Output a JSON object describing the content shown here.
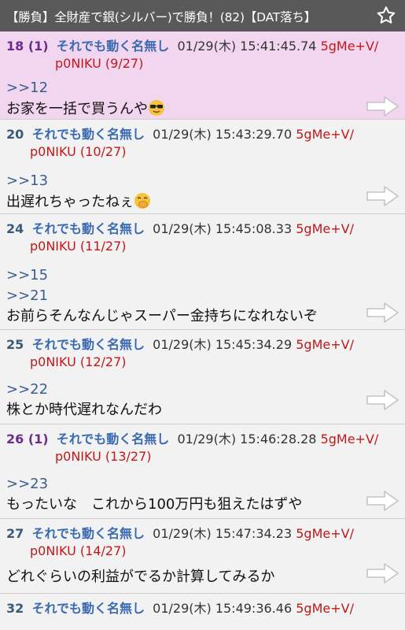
{
  "title": "【勝負】全財産で銀(シルバー)で勝負！(82)【DAT落ち】",
  "posts": [
    {
      "num": "18",
      "count": " (1)",
      "name": "それでも動く名無し",
      "date": "01/29(木) 15:41:45.74",
      "id": "5gMe+V/",
      "id2": "p0NIKU",
      "idcount": "(9/27)",
      "anchors": [
        ">>12"
      ],
      "body": "お家を一括で買うんや",
      "emoji": "sunglasses-emoji"
    },
    {
      "num": "20",
      "count": "",
      "name": "それでも動く名無し",
      "date": "01/29(木) 15:43:29.70",
      "id": "5gMe+V/",
      "id2": "p0NIKU",
      "idcount": "(10/27)",
      "anchors": [
        ">>13"
      ],
      "body": "出遅れちゃったねぇ",
      "emoji": "hand-over-mouth-emoji"
    },
    {
      "num": "24",
      "count": "",
      "name": "それでも動く名無し",
      "date": "01/29(木) 15:45:08.33",
      "id": "5gMe+V/",
      "id2": "p0NIKU",
      "idcount": "(11/27)",
      "anchors": [
        ">>15",
        ">>21"
      ],
      "body": "お前らそんなんじゃスーパー金持ちになれないぞ"
    },
    {
      "num": "25",
      "count": "",
      "name": "それでも動く名無し",
      "date": "01/29(木) 15:45:34.29",
      "id": "5gMe+V/",
      "id2": "p0NIKU",
      "idcount": "(12/27)",
      "anchors": [
        ">>22"
      ],
      "body": "株とか時代遅れなんだわ"
    },
    {
      "num": "26",
      "count": " (1)",
      "name": "それでも動く名無し",
      "date": "01/29(木) 15:46:28.28",
      "id": "5gMe+V/",
      "id2": "p0NIKU",
      "idcount": "(13/27)",
      "anchors": [
        ">>23"
      ],
      "body": "もったいな　これから100万円も狙えたはずや"
    },
    {
      "num": "27",
      "count": "",
      "name": "それでも動く名無し",
      "date": "01/29(木) 15:47:34.23",
      "id": "5gMe+V/",
      "id2": "p0NIKU",
      "idcount": "(14/27)",
      "anchors": [],
      "body": "どれぐらいの利益がでるか計算してみるか"
    },
    {
      "num": "32",
      "count": "",
      "name": "それでも動く名無し",
      "date": "01/29(木) 15:49:36.46",
      "id": "5gMe+V/",
      "id2": "",
      "idcount": "",
      "anchors": [],
      "body": ""
    }
  ],
  "colors": {
    "titlebar": "#595959",
    "highlight": "#f2d6f0",
    "id": "#c0181a",
    "name": "#3a6ab0",
    "anchor": "#3b5e8c"
  }
}
